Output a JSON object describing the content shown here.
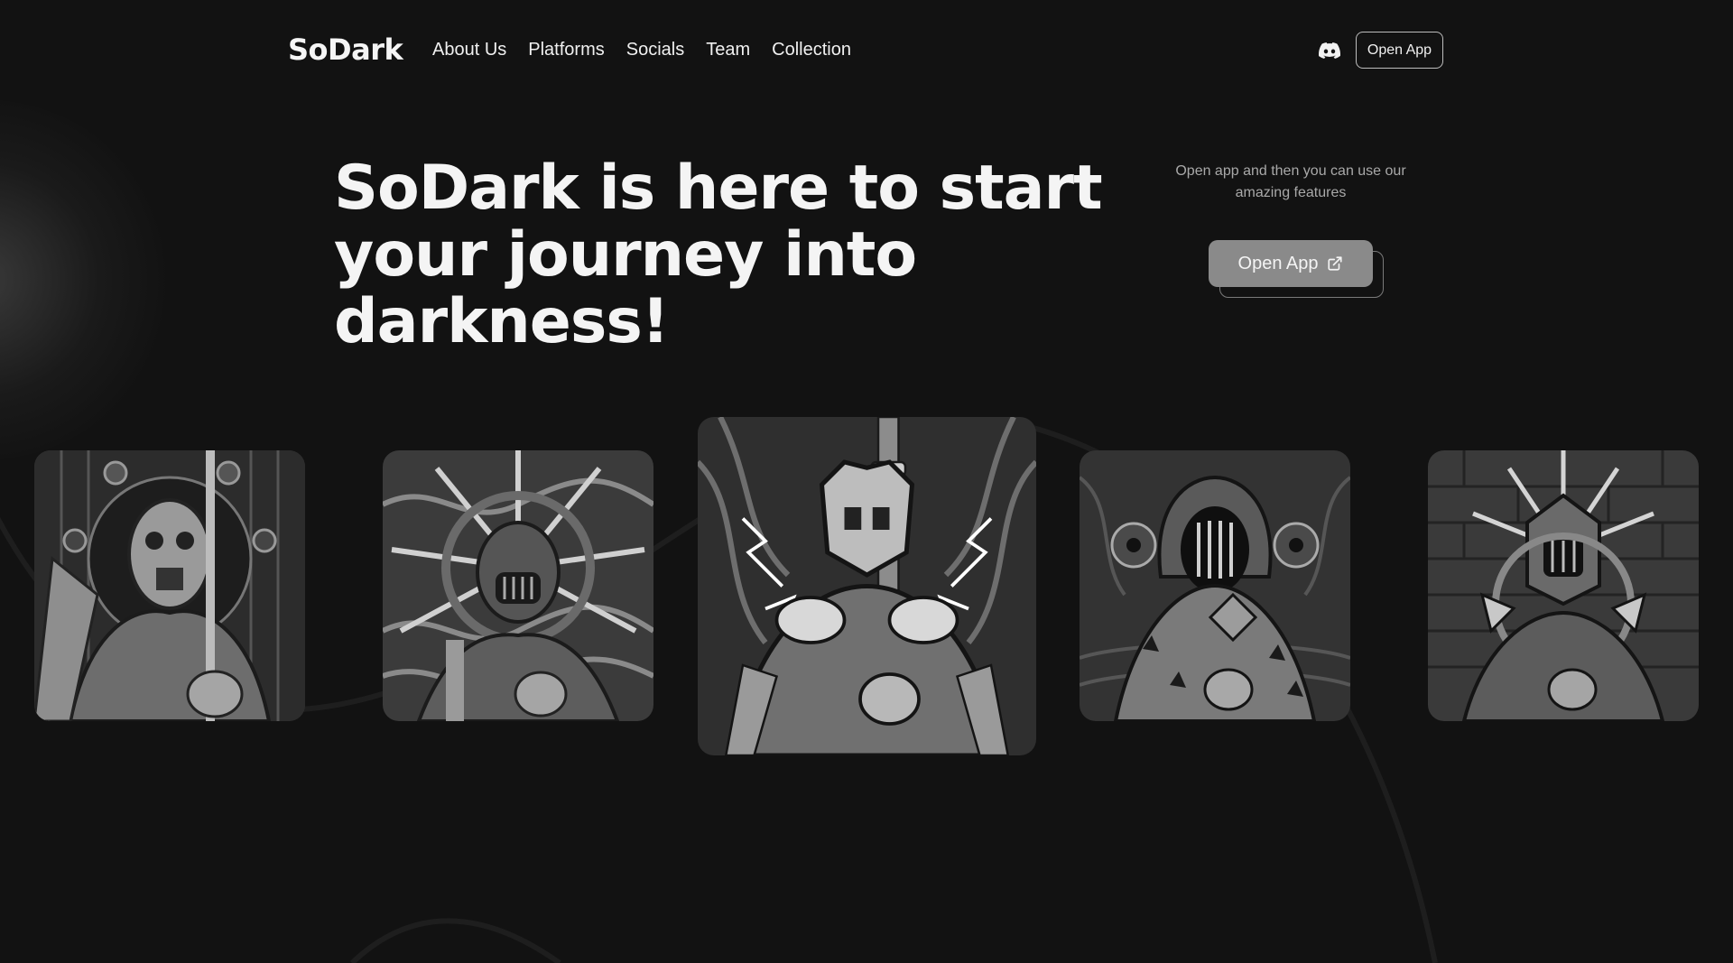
{
  "brand": {
    "logo_text": "SoDark"
  },
  "nav": {
    "items": [
      "About Us",
      "Platforms",
      "Socials",
      "Team",
      "Collection"
    ]
  },
  "header": {
    "discord_icon": "discord-icon",
    "open_app_label": "Open App"
  },
  "hero": {
    "title": "SoDark is here to start your journey into darkness!",
    "subtitle": "Open app and then you can use our amazing features",
    "cta_label": "Open App",
    "cta_icon": "external-link-icon"
  },
  "gallery": {
    "items": [
      {
        "name": "nft-card-masked-knight"
      },
      {
        "name": "nft-card-crowned-sun"
      },
      {
        "name": "nft-card-featured-lightning"
      },
      {
        "name": "nft-card-hooded-eyes"
      },
      {
        "name": "nft-card-spiked-helm"
      }
    ]
  },
  "colors": {
    "background": "#121212",
    "text": "#f4f4f4",
    "muted": "#a9a9a9",
    "cta": "#8a8a8a"
  }
}
